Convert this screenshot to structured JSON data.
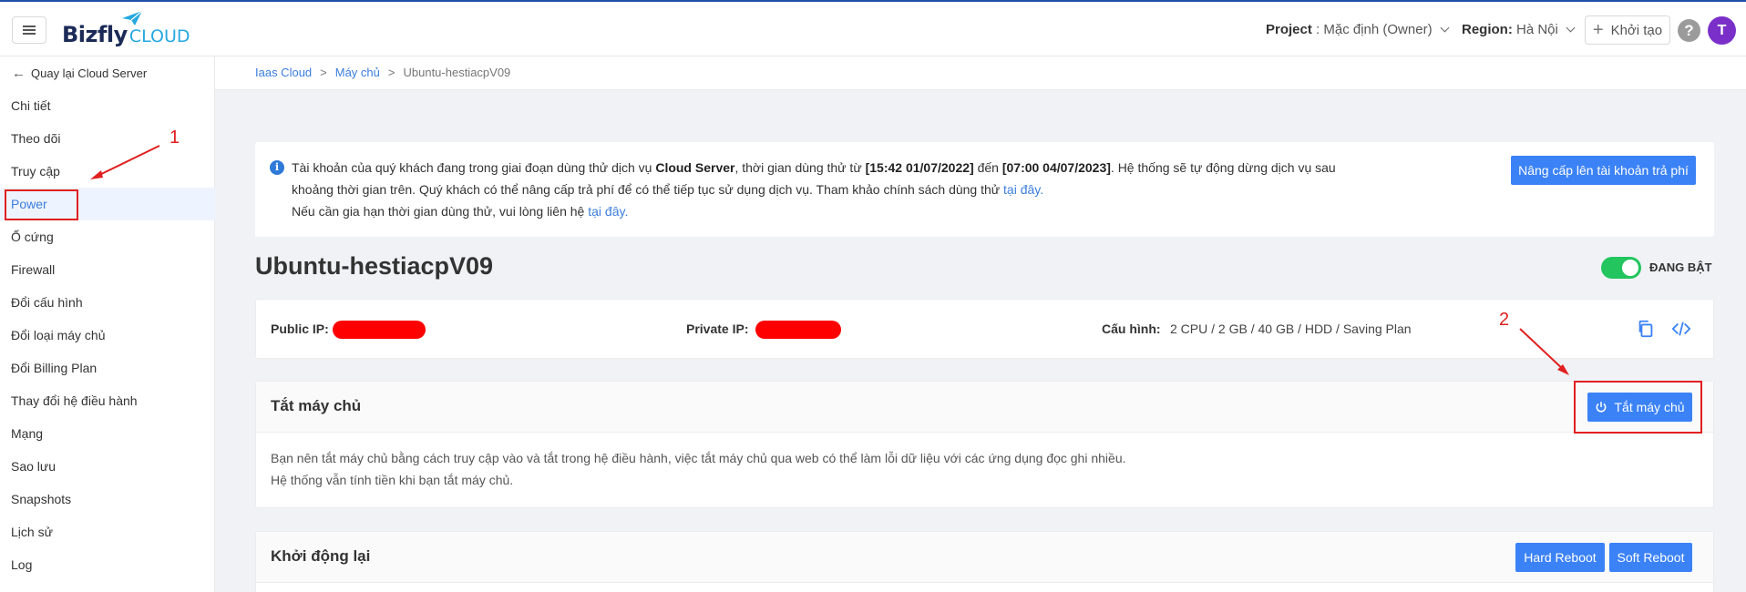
{
  "header": {
    "logo_text": "Bizfly",
    "logo_cloud": "CLOUD",
    "project_label": "Project",
    "project_value": " : Mặc định (Owner)",
    "region_label": "Region:",
    "region_value": " Hà Nội",
    "create_label": "Khởi tạo",
    "help_label": "?",
    "avatar_letter": "T"
  },
  "sidebar": {
    "back_label": "Quay lại Cloud Server",
    "items": [
      {
        "label": "Chi tiết"
      },
      {
        "label": "Theo dõi"
      },
      {
        "label": "Truy cập"
      },
      {
        "label": "Power"
      },
      {
        "label": "Ổ cứng"
      },
      {
        "label": "Firewall"
      },
      {
        "label": "Đổi cấu hình"
      },
      {
        "label": "Đổi loại máy chủ"
      },
      {
        "label": "Đổi Billing Plan"
      },
      {
        "label": "Thay đổi hệ điều hành"
      },
      {
        "label": "Mạng"
      },
      {
        "label": "Sao lưu"
      },
      {
        "label": "Snapshots"
      },
      {
        "label": "Lịch sử"
      },
      {
        "label": "Log"
      }
    ],
    "active_index": 3
  },
  "breadcrumb": [
    "Iaas Cloud",
    "Máy chủ",
    "Ubuntu-hestiacpV09"
  ],
  "notice": {
    "p1a": "Tài khoản của quý khách đang trong giai đoạn dùng thử dịch vụ ",
    "p1b": "Cloud Server",
    "p1c": ", thời gian dùng thử từ ",
    "p1d": "[15:42 01/07/2022]",
    "p1e": " đến ",
    "p1f": "[07:00 04/07/2023]",
    "p1g": ". Hệ thống sẽ tự động dừng dịch vụ sau khoảng thời gian trên. Quý khách có thể nâng cấp trả phí để có thể tiếp tục sử dụng dịch vụ. Tham khảo chính sách dùng thử ",
    "link1": "tại đây.",
    "p2": "Nếu cần gia hạn thời gian dùng thử, vui lòng liên hệ ",
    "link2": "tại đây.",
    "upgrade_label": "Nâng cấp lên tài khoản trả phí"
  },
  "server": {
    "name": "Ubuntu-hestiacpV09",
    "status": "ĐANG BẬT",
    "public_ip_label": "Public IP:",
    "private_ip_label": "Private IP:",
    "config_label": "Cấu hình:",
    "config_value": "2 CPU / 2 GB / 40 GB / HDD / Saving Plan"
  },
  "shutdown": {
    "title": "Tắt máy chủ",
    "button": "Tắt máy chủ",
    "line1": "Bạn nên tắt máy chủ bằng cách truy cập vào và tắt trong hệ điều hành, việc tắt máy chủ qua web có thể làm lỗi dữ liệu với các ứng dụng đọc ghi nhiều.",
    "line2": "Hệ thống vẫn tính tiền khi bạn tắt máy chủ."
  },
  "reboot": {
    "title": "Khởi động lại",
    "hard": "Hard Reboot",
    "soft": "Soft Reboot"
  },
  "annotations": {
    "one": "1",
    "two": "2"
  },
  "colors": {
    "accent": "#3b82f6",
    "annotation": "#e02020",
    "on": "#22c55e"
  }
}
